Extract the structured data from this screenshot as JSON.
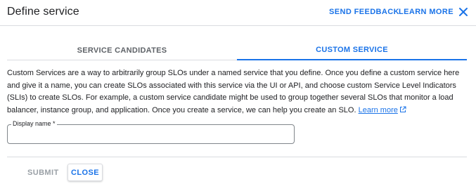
{
  "dialog": {
    "title": "Define service",
    "send_feedback_label": "SEND FEEDBACK",
    "learn_more_label": "LEARN MORE"
  },
  "tabs": [
    {
      "label": "SERVICE CANDIDATES",
      "selected": false
    },
    {
      "label": "CUSTOM SERVICE",
      "selected": true
    }
  ],
  "description": {
    "text": "Custom Services are a way to arbitrarily group SLOs under a named service that you define. Once you define a custom service here and give it a name, you can create SLOs associated with this service via the UI or API, and choose custom Service Level Indicators (SLIs) to create SLOs. For example, a custom service candidate might be used to group together several SLOs that monitor a load balancer, instance group, and application. Once you create a service, we can help you create an SLO.",
    "link_label": "Learn more"
  },
  "form": {
    "display_name_label": "Display name *",
    "display_name_value": ""
  },
  "footer": {
    "submit_label": "SUBMIT",
    "close_label": "CLOSE"
  },
  "colors": {
    "accent": "#1a73e8",
    "divider": "#dadce0",
    "disabled": "#9aa0a6"
  },
  "icons": {
    "close": "close-icon",
    "external_link": "external-link-icon"
  }
}
